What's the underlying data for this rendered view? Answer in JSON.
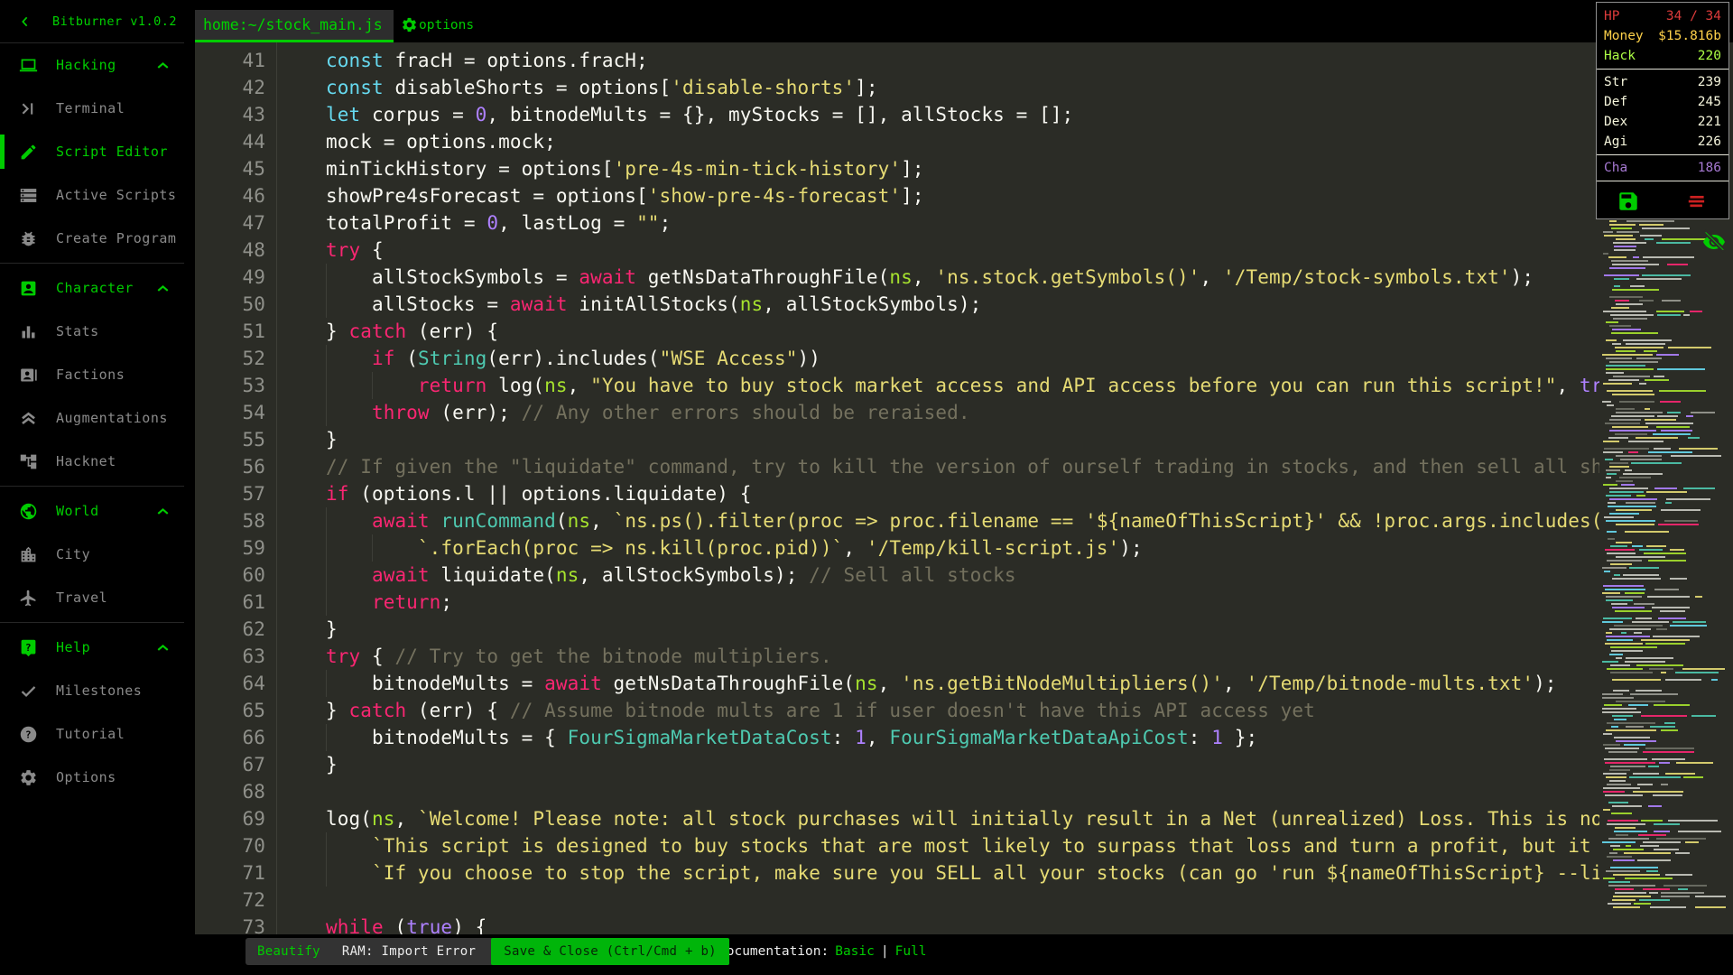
{
  "colors": {
    "accent_green": "#00cc00",
    "editor_background": "#2b2c26",
    "hp_red": "#dd3b3b",
    "money_yellow": "#ffd24a",
    "hack_green": "#adff45",
    "physical_cream": "#f5f5dc",
    "charisma_purple": "#a679d2",
    "save_button_green": "#00b50a",
    "kill_icon_red": "#cc2020"
  },
  "sidebar": {
    "title": "Bitburner v1.0.2",
    "collapse_icon": "chevron-left",
    "sections": [
      {
        "label": "Hacking",
        "icon": "laptop",
        "expanded": true,
        "items": [
          {
            "label": "Terminal",
            "icon": "terminal"
          },
          {
            "label": "Script Editor",
            "icon": "pencil",
            "active": true
          },
          {
            "label": "Active Scripts",
            "icon": "scripts"
          },
          {
            "label": "Create Program",
            "icon": "bug"
          }
        ]
      },
      {
        "label": "Character",
        "icon": "person",
        "expanded": true,
        "items": [
          {
            "label": "Stats",
            "icon": "stats"
          },
          {
            "label": "Factions",
            "icon": "factions"
          },
          {
            "label": "Augmentations",
            "icon": "augment"
          },
          {
            "label": "Hacknet",
            "icon": "hacknet"
          }
        ]
      },
      {
        "label": "World",
        "icon": "globe",
        "expanded": true,
        "items": [
          {
            "label": "City",
            "icon": "city"
          },
          {
            "label": "Travel",
            "icon": "travel"
          }
        ]
      },
      {
        "label": "Help",
        "icon": "help",
        "expanded": true,
        "items": [
          {
            "label": "Milestones",
            "icon": "check"
          },
          {
            "label": "Tutorial",
            "icon": "question"
          },
          {
            "label": "Options",
            "icon": "gear"
          }
        ]
      }
    ]
  },
  "editor": {
    "tab": "home:~/stock_main.js",
    "options_icon": "gear",
    "options_label": "options",
    "minimap_toggle_icon": "eye-off",
    "first_line_number": 41,
    "lines": [
      {
        "n": 41,
        "t": [
          [
            "tx",
            "    "
          ],
          [
            "k1",
            "const"
          ],
          [
            "tx",
            " fracH = options.fracH;"
          ]
        ]
      },
      {
        "n": 42,
        "t": [
          [
            "tx",
            "    "
          ],
          [
            "k1",
            "const"
          ],
          [
            "tx",
            " disableShorts = options["
          ],
          [
            "st",
            "'disable-shorts'"
          ],
          [
            "tx",
            "];"
          ]
        ]
      },
      {
        "n": 43,
        "t": [
          [
            "tx",
            "    "
          ],
          [
            "k1",
            "let"
          ],
          [
            "tx",
            " corpus = "
          ],
          [
            "nu",
            "0"
          ],
          [
            "tx",
            ", bitnodeMults = {}, myStocks = [], allStocks = [];"
          ]
        ]
      },
      {
        "n": 44,
        "t": [
          [
            "tx",
            "    mock = options.mock;"
          ]
        ]
      },
      {
        "n": 45,
        "t": [
          [
            "tx",
            "    minTickHistory = options["
          ],
          [
            "st",
            "'pre-4s-min-tick-history'"
          ],
          [
            "tx",
            "];"
          ]
        ]
      },
      {
        "n": 46,
        "t": [
          [
            "tx",
            "    showPre4sForecast = options["
          ],
          [
            "st",
            "'show-pre-4s-forecast'"
          ],
          [
            "tx",
            "];"
          ]
        ]
      },
      {
        "n": 47,
        "t": [
          [
            "tx",
            "    totalProfit = "
          ],
          [
            "nu",
            "0"
          ],
          [
            "tx",
            ", lastLog = "
          ],
          [
            "st",
            "\"\""
          ],
          [
            "tx",
            ";"
          ]
        ]
      },
      {
        "n": 48,
        "t": [
          [
            "tx",
            "    "
          ],
          [
            "k2",
            "try"
          ],
          [
            "tx",
            " {"
          ]
        ]
      },
      {
        "n": 49,
        "t": [
          [
            "tx",
            "        allStockSymbols = "
          ],
          [
            "k2",
            "await"
          ],
          [
            "tx",
            " getNsDataThroughFile("
          ],
          [
            "ns",
            "ns"
          ],
          [
            "tx",
            ", "
          ],
          [
            "st",
            "'ns.stock.getSymbols()'"
          ],
          [
            "tx",
            ", "
          ],
          [
            "st",
            "'/Temp/stock-symbols.txt'"
          ],
          [
            "tx",
            ");"
          ]
        ]
      },
      {
        "n": 50,
        "t": [
          [
            "tx",
            "        allStocks = "
          ],
          [
            "k2",
            "await"
          ],
          [
            "tx",
            " initAllStocks("
          ],
          [
            "ns",
            "ns"
          ],
          [
            "tx",
            ", allStockSymbols);"
          ]
        ]
      },
      {
        "n": 51,
        "t": [
          [
            "tx",
            "    } "
          ],
          [
            "k2",
            "catch"
          ],
          [
            "tx",
            " (err) {"
          ]
        ]
      },
      {
        "n": 52,
        "t": [
          [
            "tx",
            "        "
          ],
          [
            "k2",
            "if"
          ],
          [
            "tx",
            " ("
          ],
          [
            "fn",
            "String"
          ],
          [
            "tx",
            "(err).includes("
          ],
          [
            "st",
            "\"WSE Access\""
          ],
          [
            "tx",
            "))"
          ]
        ]
      },
      {
        "n": 53,
        "t": [
          [
            "tx",
            "            "
          ],
          [
            "k2",
            "return"
          ],
          [
            "tx",
            " log("
          ],
          [
            "ns",
            "ns"
          ],
          [
            "tx",
            ", "
          ],
          [
            "st",
            "\"You have to buy stock market access and API access before you can run this script!\""
          ],
          [
            "tx",
            ", "
          ],
          [
            "nu",
            "true);"
          ]
        ]
      },
      {
        "n": 54,
        "t": [
          [
            "tx",
            "        "
          ],
          [
            "k2",
            "throw"
          ],
          [
            "tx",
            " (err); "
          ],
          [
            "co",
            "// Any other errors should be reraised."
          ]
        ]
      },
      {
        "n": 55,
        "t": [
          [
            "tx",
            "    }"
          ]
        ]
      },
      {
        "n": 56,
        "t": [
          [
            "tx",
            "    "
          ],
          [
            "co",
            "// If given the \"liquidate\" command, try to kill the version of ourself trading in stocks, and then sell all shares."
          ]
        ]
      },
      {
        "n": 57,
        "t": [
          [
            "tx",
            "    "
          ],
          [
            "k2",
            "if"
          ],
          [
            "tx",
            " (options.l || options.liquidate) {"
          ]
        ]
      },
      {
        "n": 58,
        "t": [
          [
            "tx",
            "        "
          ],
          [
            "k2",
            "await"
          ],
          [
            "tx",
            " "
          ],
          [
            "fn",
            "runCommand"
          ],
          [
            "tx",
            "("
          ],
          [
            "ns",
            "ns"
          ],
          [
            "tx",
            ", "
          ],
          [
            "st",
            "`ns.ps().filter(proc => proc.filename == '${nameOfThisScript}' && !proc.args.includes('-l')`"
          ]
        ]
      },
      {
        "n": 59,
        "t": [
          [
            "tx",
            "            "
          ],
          [
            "st",
            "`.forEach(proc => ns.kill(proc.pid))`"
          ],
          [
            "tx",
            ", "
          ],
          [
            "st",
            "'/Temp/kill-script.js'"
          ],
          [
            "tx",
            ");"
          ]
        ]
      },
      {
        "n": 60,
        "t": [
          [
            "tx",
            "        "
          ],
          [
            "k2",
            "await"
          ],
          [
            "tx",
            " liquidate("
          ],
          [
            "ns",
            "ns"
          ],
          [
            "tx",
            ", allStockSymbols); "
          ],
          [
            "co",
            "// Sell all stocks"
          ]
        ]
      },
      {
        "n": 61,
        "t": [
          [
            "tx",
            "        "
          ],
          [
            "k2",
            "return"
          ],
          [
            "tx",
            ";"
          ]
        ]
      },
      {
        "n": 62,
        "t": [
          [
            "tx",
            "    }"
          ]
        ]
      },
      {
        "n": 63,
        "t": [
          [
            "tx",
            "    "
          ],
          [
            "k2",
            "try"
          ],
          [
            "tx",
            " { "
          ],
          [
            "co",
            "// Try to get the bitnode multipliers."
          ]
        ]
      },
      {
        "n": 64,
        "t": [
          [
            "tx",
            "        bitnodeMults = "
          ],
          [
            "k2",
            "await"
          ],
          [
            "tx",
            " getNsDataThroughFile("
          ],
          [
            "ns",
            "ns"
          ],
          [
            "tx",
            ", "
          ],
          [
            "st",
            "'ns.getBitNodeMultipliers()'"
          ],
          [
            "tx",
            ", "
          ],
          [
            "st",
            "'/Temp/bitnode-mults.txt'"
          ],
          [
            "tx",
            ");"
          ]
        ]
      },
      {
        "n": 65,
        "t": [
          [
            "tx",
            "    } "
          ],
          [
            "k2",
            "catch"
          ],
          [
            "tx",
            " (err) { "
          ],
          [
            "co",
            "// Assume bitnode mults are 1 if user doesn't have this API access yet"
          ]
        ]
      },
      {
        "n": 66,
        "t": [
          [
            "tx",
            "        bitnodeMults = { "
          ],
          [
            "fn",
            "FourSigmaMarketDataCost"
          ],
          [
            "tx",
            ": "
          ],
          [
            "nu",
            "1"
          ],
          [
            "tx",
            ", "
          ],
          [
            "fn",
            "FourSigmaMarketDataApiCost"
          ],
          [
            "tx",
            ": "
          ],
          [
            "nu",
            "1"
          ],
          [
            "tx",
            " };"
          ]
        ]
      },
      {
        "n": 67,
        "t": [
          [
            "tx",
            "    }"
          ]
        ]
      },
      {
        "n": 68,
        "t": []
      },
      {
        "n": 69,
        "t": [
          [
            "tx",
            "    log("
          ],
          [
            "ns",
            "ns"
          ],
          [
            "tx",
            ", "
          ],
          [
            "st",
            "`Welcome! Please note: all stock purchases will initially result in a Net (unrealized) Loss. This is not only expected, `"
          ]
        ]
      },
      {
        "n": 70,
        "t": [
          [
            "tx",
            "        "
          ],
          [
            "st",
            "`This script is designed to buy stocks that are most likely to surpass that loss and turn a profit, but it will take time, `"
          ]
        ]
      },
      {
        "n": 71,
        "t": [
          [
            "tx",
            "        "
          ],
          [
            "st",
            "`If you choose to stop the script, make sure you SELL all your stocks (can go 'run ${nameOfThisScript} --liquidate') to get `"
          ]
        ]
      },
      {
        "n": 72,
        "t": []
      },
      {
        "n": 73,
        "t": [
          [
            "tx",
            "    "
          ],
          [
            "k2",
            "while"
          ],
          [
            "tx",
            " ("
          ],
          [
            "nu",
            "true"
          ],
          [
            "tx",
            ") {"
          ]
        ]
      }
    ]
  },
  "overview": {
    "rows": [
      {
        "label": "HP",
        "value": "34 / 34",
        "cls": "hp"
      },
      {
        "label": "Money",
        "value": "$15.816b",
        "cls": "money"
      },
      {
        "label": "Hack",
        "value": "220",
        "cls": "hack",
        "divider_after": true
      },
      {
        "label": "Str",
        "value": "239",
        "cls": "phys"
      },
      {
        "label": "Def",
        "value": "245",
        "cls": "phys"
      },
      {
        "label": "Dex",
        "value": "221",
        "cls": "phys"
      },
      {
        "label": "Agi",
        "value": "226",
        "cls": "phys",
        "divider_after": true
      },
      {
        "label": "Cha",
        "value": "186",
        "cls": "cha",
        "divider_after": true
      }
    ],
    "actions": [
      {
        "name": "save-game",
        "icon": "save"
      },
      {
        "name": "kill-all-scripts",
        "icon": "kill"
      }
    ]
  },
  "toolbar": {
    "beautify": "Beautify",
    "ram": "RAM: Import Error",
    "save_close": "Save & Close (Ctrl/Cmd + b)",
    "documentation": "Documentation:",
    "basic": "Basic",
    "separator": "|",
    "full": "Full"
  }
}
